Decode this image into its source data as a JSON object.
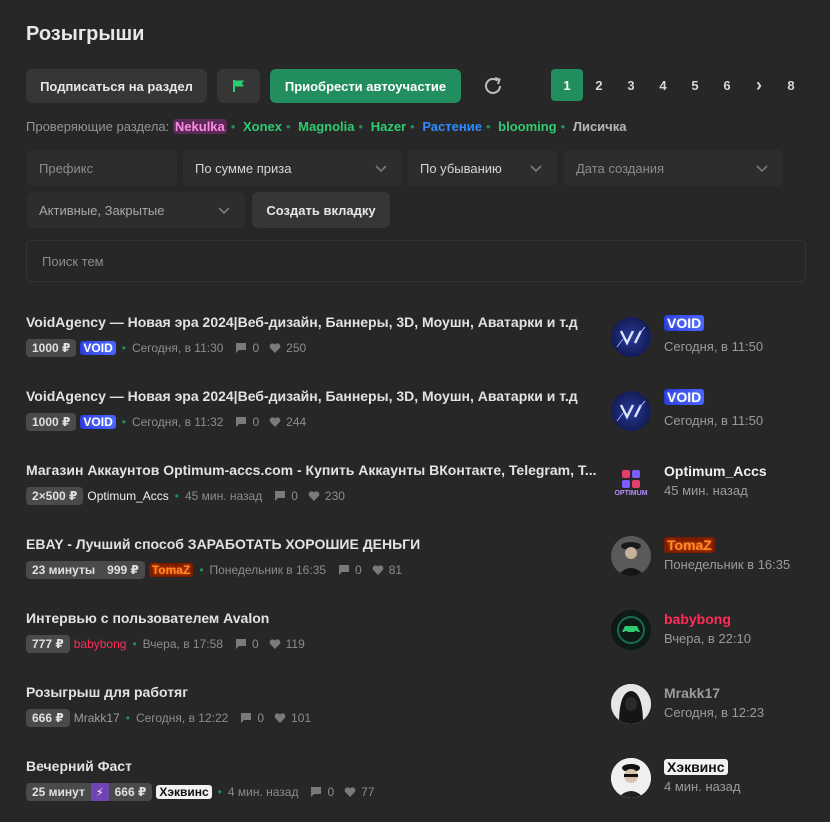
{
  "page": {
    "title": "Розыгрыши"
  },
  "toolbar": {
    "subscribe_label": "Подписаться на раздел",
    "flag_icon": "flag-icon",
    "auto_label": "Приобрести автоучастие",
    "refresh_icon": "refresh-icon"
  },
  "pagination": {
    "pages": [
      "1",
      "2",
      "3",
      "4",
      "5",
      "6",
      "›",
      "8"
    ],
    "current": "1"
  },
  "moderators": {
    "label": "Проверяющие раздела:",
    "names": [
      {
        "name": "Nekulka",
        "color": "#ff8be8"
      },
      {
        "name": "Xonex",
        "color": "#2ecc71"
      },
      {
        "name": "Magnolia",
        "color": "#2ecc71"
      },
      {
        "name": "Hazer",
        "color": "#2ecc71"
      },
      {
        "name": "Растение",
        "color": "#2f8bff"
      },
      {
        "name": "blooming",
        "color": "#2ecc71"
      },
      {
        "name": "Лисичка",
        "color": "#b7b7b7"
      }
    ]
  },
  "filters": {
    "prefix_placeholder": "Префикс",
    "sort_by": "По сумме приза",
    "order": "По убыванию",
    "date_placeholder": "Дата создания",
    "status": "Активные, Закрытые",
    "create_tab_label": "Создать вкладку",
    "search_placeholder": "Поиск тем"
  },
  "colors": {
    "accent": "#228e5d",
    "background": "#272727"
  },
  "threads": [
    {
      "title": "VoidAgency — Новая эра 2024|Веб-дизайн, Баннеры, 3D, Моушн, Аватарки и т.д",
      "prize": "1000 ₽",
      "author": "VOID",
      "date": "Сегодня, в 11:30",
      "replies": "0",
      "likes": "250",
      "last_poster": "VOID",
      "last_time": "Сегодня, в 11:50"
    },
    {
      "title": "VoidAgency — Новая эра 2024|Веб-дизайн, Баннеры, 3D, Моушн, Аватарки и т.д",
      "prize": "1000 ₽",
      "author": "VOID",
      "date": "Сегодня, в 11:32",
      "replies": "0",
      "likes": "244",
      "last_poster": "VOID",
      "last_time": "Сегодня, в 11:50"
    },
    {
      "title": "Магазин Аккаунтов Optimum-accs.com - Купить Аккаунты ВКонтакте, Telegram, T...",
      "prize": "2×500 ₽",
      "author": "Optimum_Accs",
      "date": "45 мин. назад",
      "replies": "0",
      "likes": "230",
      "last_poster": "Optimum_Accs",
      "last_time": "45 мин. назад",
      "avatar_text": "OPTIMUM"
    },
    {
      "title": "EBAY - Лучший способ ЗАРАБОТАТЬ ХОРОШИЕ ДЕНЬГИ",
      "duration": "23 минуты",
      "prize": "999 ₽",
      "author": "TomaZ",
      "date": "Понедельник в 16:35",
      "replies": "0",
      "likes": "81",
      "last_poster": "TomaZ",
      "last_time": "Понедельник в 16:35"
    },
    {
      "title": "Интервью с пользователем Avalon",
      "prize": "777 ₽",
      "author": "babybong",
      "date": "Вчера, в 17:58",
      "replies": "0",
      "likes": "119",
      "last_poster": "babybong",
      "last_time": "Вчера, в 22:10"
    },
    {
      "title": "Розыгрыш для работяг",
      "prize": "666 ₽",
      "author": "Mrakk17",
      "date": "Сегодня, в 12:22",
      "replies": "0",
      "likes": "101",
      "last_poster": "Mrakk17",
      "last_time": "Сегодня, в 12:23"
    },
    {
      "title": "Вечерний Фаст",
      "duration": "25 минут",
      "prize": "666 ₽",
      "author": "Хэквинс",
      "date": "4 мин. назад",
      "replies": "0",
      "likes": "77",
      "last_poster": "Хэквинс",
      "last_time": "4 мин. назад"
    }
  ]
}
